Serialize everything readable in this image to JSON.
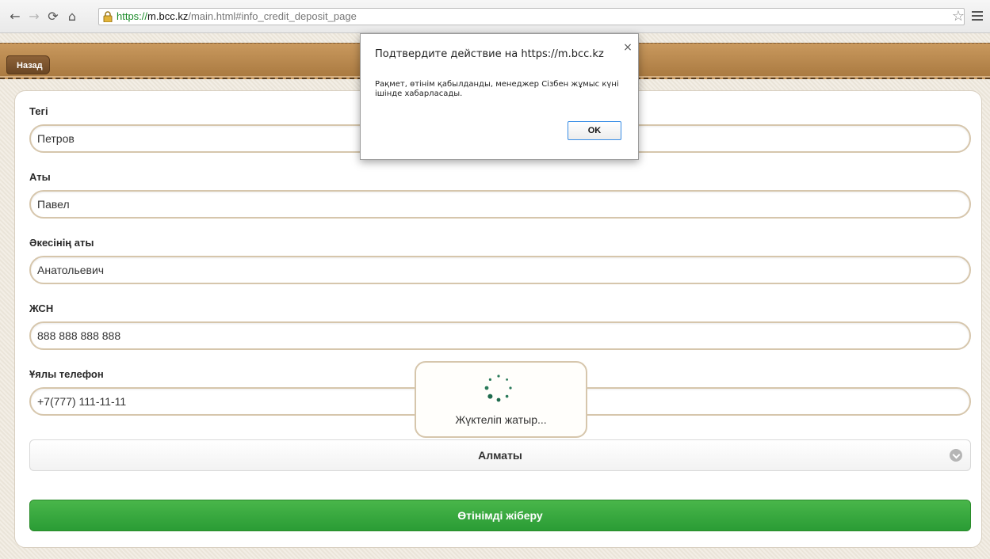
{
  "browser": {
    "url_scheme": "https://",
    "url_domain": "m.bcc.kz",
    "url_path": "/main.html#info_credit_deposit_page",
    "back_icon": "arrow-left",
    "forward_icon": "arrow-right",
    "reload_icon": "reload",
    "home_icon": "home",
    "lock_icon": "lock",
    "star_icon": "star",
    "menu_icon": "menu"
  },
  "header": {
    "back_label": "Назад"
  },
  "form": {
    "fields": [
      {
        "label": "Тегі",
        "value": "Петров"
      },
      {
        "label": "Аты",
        "value": "Павел"
      },
      {
        "label": "Әкесінің аты",
        "value": "Анатольевич"
      },
      {
        "label": "ЖСН",
        "value": "888 888 888 888"
      },
      {
        "label": "Ұялы телефон",
        "value": "+7(777) 111-11-11"
      }
    ],
    "city_select": "Алматы",
    "submit_label": "Өтінімді жіберу"
  },
  "loader": {
    "text": "Жүктеліп жатыр..."
  },
  "dialog": {
    "title": "Подтвердите действие на https://m.bcc.kz",
    "close": "×",
    "message": "Рақмет, өтінім қабылданды, менеджер Сізбен жұмыс күні ішінде хабарласады.",
    "ok_label": "OK"
  },
  "colors": {
    "submit_green": "#2a9c35",
    "header_leather": "#b8874d"
  }
}
